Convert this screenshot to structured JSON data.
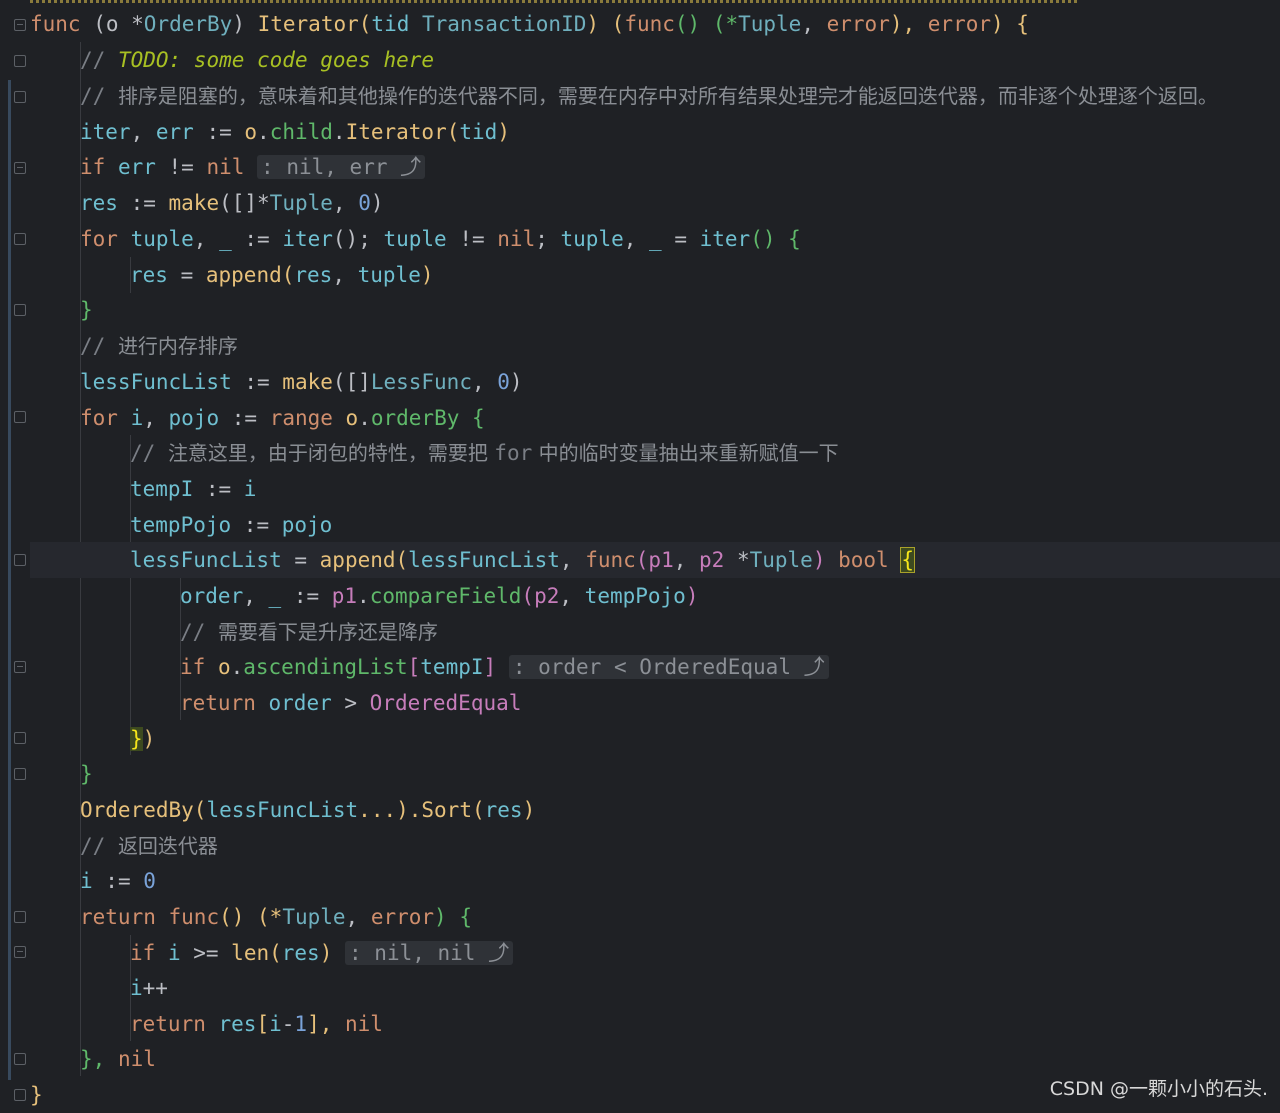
{
  "editor": {
    "language": "go",
    "colors": {
      "background": "#1f2125",
      "keyword": "#cf8e6d",
      "function": "#e6c07b",
      "type": "#6fafbd",
      "comment": "#7a7e85",
      "hint_bg": "#2f3237"
    },
    "lines": {
      "l1": {
        "t1": "func",
        "t2": " (o *",
        "t3": "OrderBy",
        "t4": ") ",
        "t5": "Iterator",
        "t6": "(",
        "t7": "tid",
        "t8": " TransactionID",
        "t9": ") (",
        "t10": "func",
        "t11": "() (*",
        "t12": "Tuple",
        "t13": ", ",
        "t14": "error",
        "t15": "), ",
        "t16": "error",
        "t17": ") {"
      },
      "l2": {
        "t1": "// ",
        "t2": "TODO: some code goes here"
      },
      "l3": {
        "t1": "// ",
        "t2": "排序是阻塞的，意味着和其他操作的迭代器不同，需要在内存中对所有结果处理完才能返回迭代器，而非逐个处理逐个返回。"
      },
      "l4": {
        "t1": "iter",
        "t2": ", ",
        "t3": "err",
        "t4": " := ",
        "t5": "o",
        "t6": ".",
        "t7": "child",
        "t8": ".",
        "t9": "Iterator",
        "t10": "(",
        "t11": "tid",
        "t12": ")"
      },
      "l5": {
        "t1": "if ",
        "t2": "err",
        "t3": " != ",
        "t4": "nil",
        "t5": " ",
        "t6": ": nil, err ⤴"
      },
      "l6": {
        "t1": "res",
        "t2": " := ",
        "t3": "make",
        "t4": "([]*",
        "t5": "Tuple",
        "t6": ", ",
        "t7": "0",
        "t8": ")"
      },
      "l7": {
        "t1": "for ",
        "t2": "tuple",
        "t3": ", ",
        "t4": "_",
        "t5": " := ",
        "t6": "iter",
        "t7": "(); ",
        "t8": "tuple",
        "t9": " != ",
        "t10": "nil",
        "t11": "; ",
        "t12": "tuple",
        "t13": ", ",
        "t14": "_",
        "t15": " = ",
        "t16": "iter",
        "t17": "() {"
      },
      "l8": {
        "t1": "res",
        "t2": " = ",
        "t3": "append",
        "t4": "(",
        "t5": "res",
        "t6": ", ",
        "t7": "tuple",
        "t8": ")"
      },
      "l9": {
        "t1": "}"
      },
      "l10": {
        "t1": "// ",
        "t2": "进行内存排序"
      },
      "l11": {
        "t1": "lessFuncList",
        "t2": " := ",
        "t3": "make",
        "t4": "([]",
        "t5": "LessFunc",
        "t6": ", ",
        "t7": "0",
        "t8": ")"
      },
      "l12": {
        "t1": "for ",
        "t2": "i",
        "t3": ", ",
        "t4": "pojo",
        "t5": " := ",
        "t6": "range ",
        "t7": "o",
        "t8": ".",
        "t9": "orderBy",
        "t10": " {"
      },
      "l13": {
        "t1": "// ",
        "t2": "注意这里，由于闭包的特性，需要把 ",
        "t3": "for",
        "t4": " 中的临时变量抽出来重新赋值一下"
      },
      "l14": {
        "t1": "tempI",
        "t2": " := ",
        "t3": "i"
      },
      "l15": {
        "t1": "tempPojo",
        "t2": " := ",
        "t3": "pojo"
      },
      "l16": {
        "t1": "lessFuncList",
        "t2": " = ",
        "t3": "append",
        "t4": "(",
        "t5": "lessFuncList",
        "t6": ", ",
        "t7": "func",
        "t8": "(",
        "t9": "p1",
        "t10": ", ",
        "t11": "p2",
        "t12": " *",
        "t13": "Tuple",
        "t14": ") ",
        "t15": "bool",
        "t16": " ",
        "t17": "{"
      },
      "l17": {
        "t1": "order",
        "t2": ", ",
        "t3": "_",
        "t4": " := ",
        "t5": "p1",
        "t6": ".",
        "t7": "compareField",
        "t8": "(",
        "t9": "p2",
        "t10": ", ",
        "t11": "tempPojo",
        "t12": ")"
      },
      "l18": {
        "t1": "// ",
        "t2": "需要看下是升序还是降序"
      },
      "l19": {
        "t1": "if ",
        "t2": "o",
        "t3": ".",
        "t4": "ascendingList",
        "t5": "[",
        "t6": "tempI",
        "t7": "]",
        "t8": " ",
        "t9": ": order < OrderedEqual ⤴"
      },
      "l20": {
        "t1": "return ",
        "t2": "order",
        "t3": " > ",
        "t4": "OrderedEqual"
      },
      "l21": {
        "t1": "}",
        "t2": ")"
      },
      "l22": {
        "t1": "}"
      },
      "l23": {
        "t1": "OrderedBy",
        "t2": "(",
        "t3": "lessFuncList",
        "t4": "...).",
        "t5": "Sort",
        "t6": "(",
        "t7": "res",
        "t8": ")"
      },
      "l24": {
        "t1": "// ",
        "t2": "返回迭代器"
      },
      "l25": {
        "t1": "i",
        "t2": " := ",
        "t3": "0"
      },
      "l26": {
        "t1": "return ",
        "t2": "func",
        "t3": "() (*",
        "t4": "Tuple",
        "t5": ", ",
        "t6": "error",
        "t7": ") {"
      },
      "l27": {
        "t1": "if ",
        "t2": "i",
        "t3": " >= ",
        "t4": "len",
        "t5": "(",
        "t6": "res",
        "t7": ")",
        "t8": " ",
        "t9": ": nil, nil ⤴"
      },
      "l28": {
        "t1": "i",
        "t2": "++"
      },
      "l29": {
        "t1": "return ",
        "t2": "res",
        "t3": "[",
        "t4": "i",
        "t5": "-",
        "t6": "1",
        "t7": "], ",
        "t8": "nil"
      },
      "l30": {
        "t1": "}, ",
        "t2": "nil"
      },
      "l31": {
        "t1": "}"
      }
    }
  },
  "watermark": "CSDN @一颗小小的石头."
}
